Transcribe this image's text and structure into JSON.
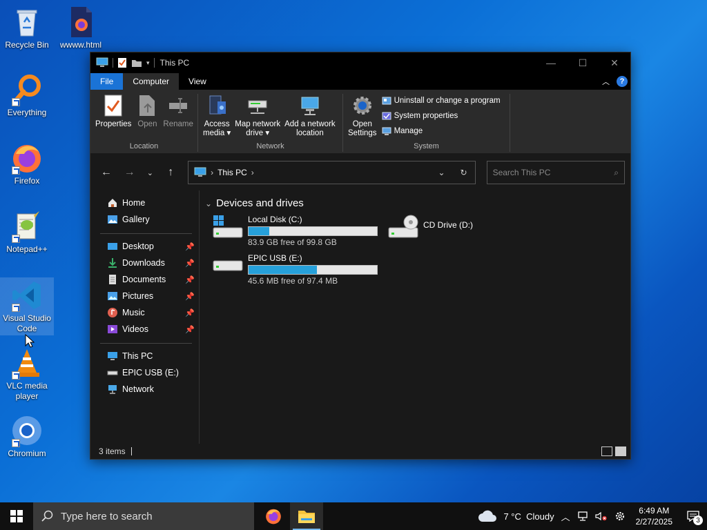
{
  "desktop": {
    "icons": [
      {
        "label": "Recycle Bin"
      },
      {
        "label": "wwww.html"
      },
      {
        "label": "Everything"
      },
      {
        "label": "Firefox"
      },
      {
        "label": "Notepad++"
      },
      {
        "label": "Visual Studio Code"
      },
      {
        "label": "VLC media player"
      },
      {
        "label": "Chromium"
      }
    ]
  },
  "window": {
    "title": "This PC",
    "ribbon_tabs": [
      "File",
      "Computer",
      "View"
    ],
    "active_tab": "Computer",
    "ribbon": {
      "location": {
        "label": "Location",
        "buttons": [
          "Properties",
          "Open",
          "Rename"
        ]
      },
      "network": {
        "label": "Network",
        "buttons": [
          {
            "line1": "Access",
            "line2": "media"
          },
          {
            "line1": "Map network",
            "line2": "drive"
          },
          {
            "line1": "Add a network",
            "line2": "location"
          }
        ]
      },
      "system": {
        "label": "System",
        "open_settings": {
          "line1": "Open",
          "line2": "Settings"
        },
        "items": [
          "Uninstall or change a program",
          "System properties",
          "Manage"
        ]
      }
    },
    "address": {
      "crumb": "This PC"
    },
    "search": {
      "placeholder": "Search This PC"
    },
    "nav": {
      "items": [
        {
          "label": "Home"
        },
        {
          "label": "Gallery"
        },
        {
          "label": "Desktop"
        },
        {
          "label": "Downloads"
        },
        {
          "label": "Documents"
        },
        {
          "label": "Pictures"
        },
        {
          "label": "Music"
        },
        {
          "label": "Videos"
        },
        {
          "label": "This PC"
        },
        {
          "label": "EPIC USB (E:)"
        },
        {
          "label": "Network"
        }
      ]
    },
    "section": {
      "title": "Devices and drives"
    },
    "drives": [
      {
        "name": "Local Disk (C:)",
        "free": "83.9 GB free of 99.8 GB",
        "used_fraction": 0.16
      },
      {
        "name": "CD Drive (D:)"
      },
      {
        "name": "EPIC USB (E:)",
        "free": "45.6 MB free of 97.4 MB",
        "used_fraction": 0.53
      }
    ],
    "status": {
      "items": "3 items"
    }
  },
  "taskbar": {
    "search_placeholder": "Type here to search",
    "weather": "7 °C  Cloudy",
    "time": "6:49 AM",
    "date": "2/27/2025",
    "notification_count": "3"
  },
  "colors": {
    "accent": "#1a73d6",
    "progress": "#26a0da"
  }
}
